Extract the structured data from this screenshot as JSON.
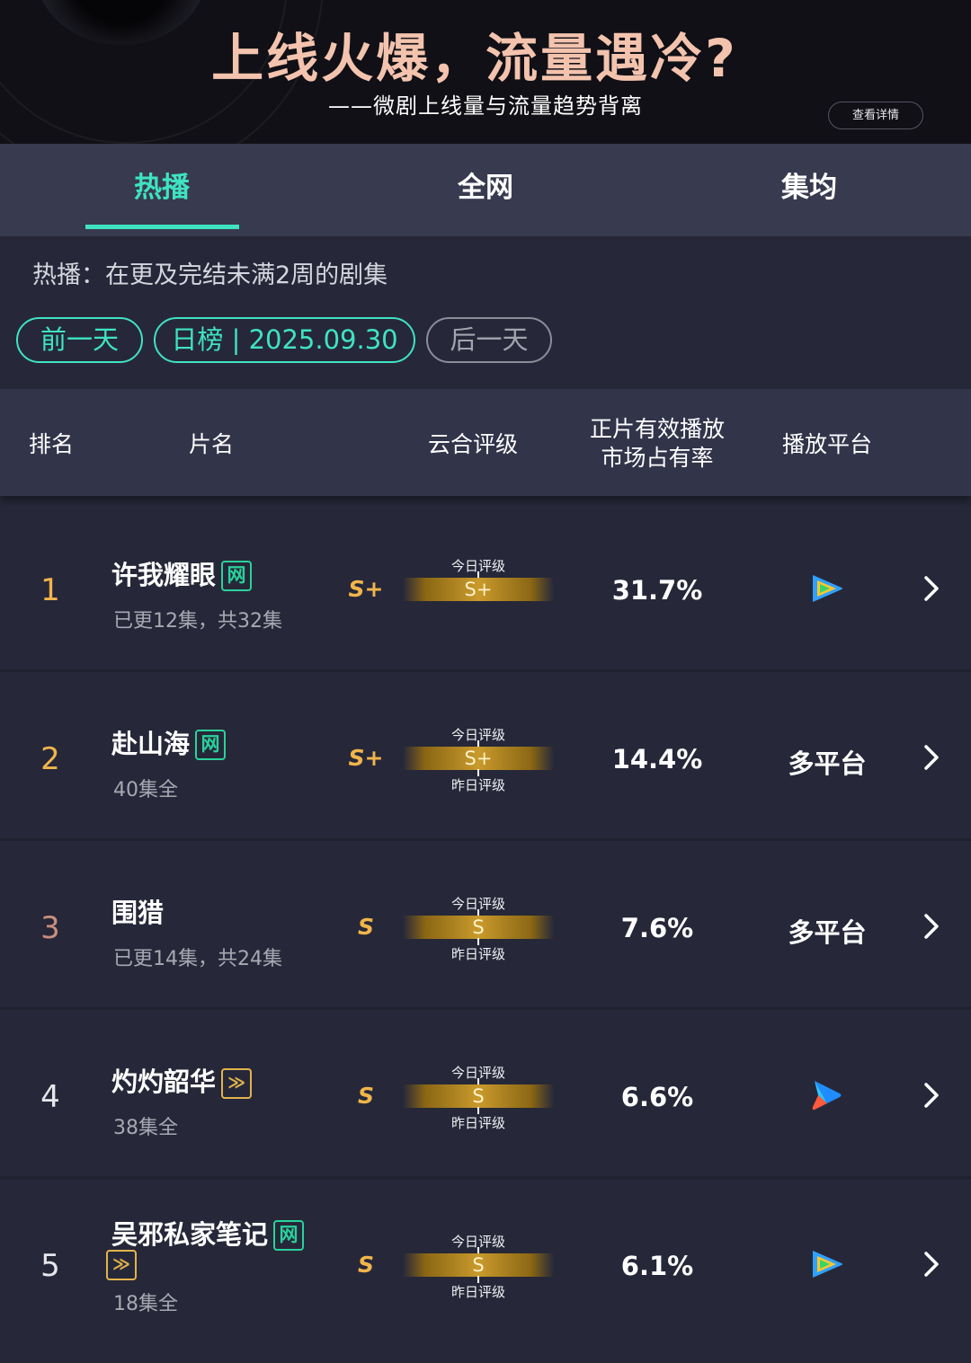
{
  "banner": {
    "title": "上线火爆，流量遇冷?",
    "subtitle": "——微剧上线量与流量趋势背离",
    "detail_button": "查看详情"
  },
  "tabs": [
    {
      "label": "热播",
      "active": true
    },
    {
      "label": "全网",
      "active": false
    },
    {
      "label": "集均",
      "active": false
    }
  ],
  "description": "热播：在更及完结未满2周的剧集",
  "date_nav": {
    "prev": "前一天",
    "current": "日榜 | 2025.09.30",
    "next": "后一天"
  },
  "table_header": {
    "rank": "排名",
    "title": "片名",
    "rating": "云合评级",
    "share_line1": "正片有效播放",
    "share_line2": "市场占有率",
    "platform": "播放平台"
  },
  "meter_labels": {
    "today": "今日评级",
    "yesterday": "昨日评级"
  },
  "rows": [
    {
      "rank": "1",
      "rank_color": "#f1b54a",
      "title": "许我耀眼",
      "tags": [
        "网"
      ],
      "episodes": "已更12集，共32集",
      "grade": "S+",
      "today_grade": "S+",
      "share": "31.7%",
      "platform": "",
      "platform_icon": "tencent-video-icon"
    },
    {
      "rank": "2",
      "rank_color": "#f1b54a",
      "title": "赴山海",
      "tags": [
        "网"
      ],
      "episodes": "40集全",
      "grade": "S+",
      "today_grade": "S+",
      "share": "14.4%",
      "platform": "多平台",
      "platform_icon": ""
    },
    {
      "rank": "3",
      "rank_color": "#c98f7e",
      "title": "围猎",
      "tags": [],
      "episodes": "已更14集，共24集",
      "grade": "S",
      "today_grade": "S",
      "share": "7.6%",
      "platform": "多平台",
      "platform_icon": ""
    },
    {
      "rank": "4",
      "rank_color": "#e6e6ec",
      "title": "灼灼韶华",
      "tags": [
        "youku"
      ],
      "episodes": "38集全",
      "grade": "S",
      "today_grade": "S",
      "share": "6.6%",
      "platform": "",
      "platform_icon": "youku-icon"
    },
    {
      "rank": "5",
      "rank_color": "#e6e6ec",
      "title": "吴邪私家笔记",
      "tags": [
        "网",
        "youku"
      ],
      "episodes": "18集全",
      "grade": "S",
      "today_grade": "S",
      "share": "6.1%",
      "platform": "",
      "platform_icon": "tencent-video-icon"
    }
  ],
  "colors": {
    "accent": "#3fe3c2",
    "gold": "#f1b54a",
    "tag_green": "#2ad29b",
    "tag_yellow": "#e3b34d"
  }
}
